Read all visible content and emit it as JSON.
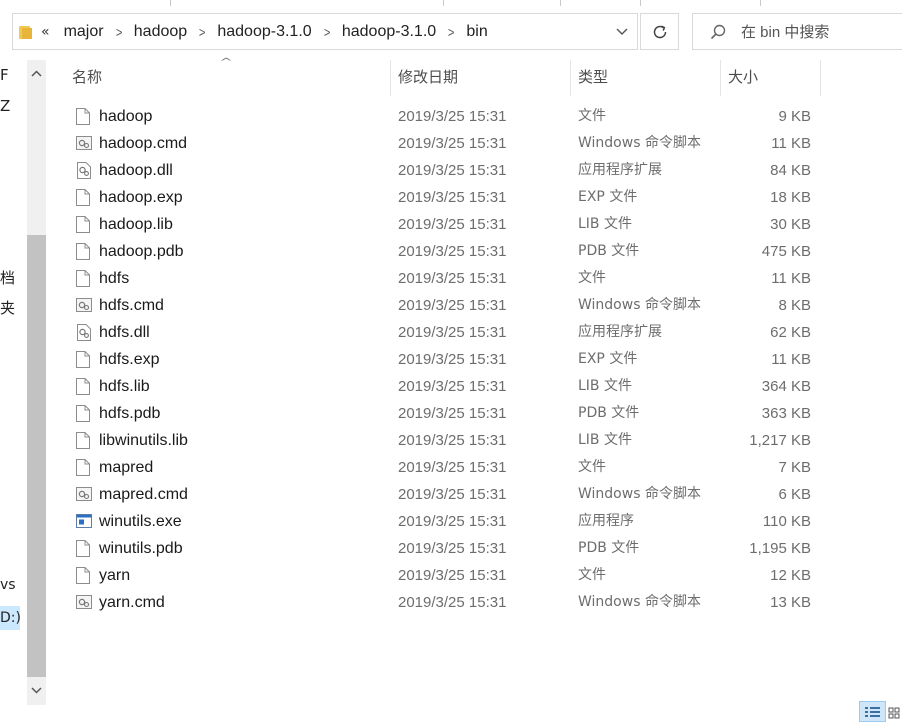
{
  "addressbar": {
    "overflow": "«",
    "crumbs": [
      "major",
      "hadoop",
      "hadoop-3.1.0",
      "hadoop-3.1.0",
      "bin"
    ]
  },
  "search": {
    "placeholder": "在 bin 中搜索"
  },
  "nav_fragments": [
    "F",
    "Z",
    "档",
    "夹",
    "vs (C",
    "D:)"
  ],
  "columns": {
    "name": "名称",
    "date": "修改日期",
    "type": "类型",
    "size": "大小"
  },
  "files": [
    {
      "name": "hadoop",
      "date": "2019/3/25 15:31",
      "type": "文件",
      "size": "9 KB",
      "icon": "blank-file-icon"
    },
    {
      "name": "hadoop.cmd",
      "date": "2019/3/25 15:31",
      "type": "Windows 命令脚本",
      "size": "11 KB",
      "icon": "cmd-script-icon"
    },
    {
      "name": "hadoop.dll",
      "date": "2019/3/25 15:31",
      "type": "应用程序扩展",
      "size": "84 KB",
      "icon": "dll-file-icon"
    },
    {
      "name": "hadoop.exp",
      "date": "2019/3/25 15:31",
      "type": "EXP 文件",
      "size": "18 KB",
      "icon": "blank-file-icon"
    },
    {
      "name": "hadoop.lib",
      "date": "2019/3/25 15:31",
      "type": "LIB 文件",
      "size": "30 KB",
      "icon": "blank-file-icon"
    },
    {
      "name": "hadoop.pdb",
      "date": "2019/3/25 15:31",
      "type": "PDB 文件",
      "size": "475 KB",
      "icon": "blank-file-icon"
    },
    {
      "name": "hdfs",
      "date": "2019/3/25 15:31",
      "type": "文件",
      "size": "11 KB",
      "icon": "blank-file-icon"
    },
    {
      "name": "hdfs.cmd",
      "date": "2019/3/25 15:31",
      "type": "Windows 命令脚本",
      "size": "8 KB",
      "icon": "cmd-script-icon"
    },
    {
      "name": "hdfs.dll",
      "date": "2019/3/25 15:31",
      "type": "应用程序扩展",
      "size": "62 KB",
      "icon": "dll-file-icon"
    },
    {
      "name": "hdfs.exp",
      "date": "2019/3/25 15:31",
      "type": "EXP 文件",
      "size": "11 KB",
      "icon": "blank-file-icon"
    },
    {
      "name": "hdfs.lib",
      "date": "2019/3/25 15:31",
      "type": "LIB 文件",
      "size": "364 KB",
      "icon": "blank-file-icon"
    },
    {
      "name": "hdfs.pdb",
      "date": "2019/3/25 15:31",
      "type": "PDB 文件",
      "size": "363 KB",
      "icon": "blank-file-icon"
    },
    {
      "name": "libwinutils.lib",
      "date": "2019/3/25 15:31",
      "type": "LIB 文件",
      "size": "1,217 KB",
      "icon": "blank-file-icon"
    },
    {
      "name": "mapred",
      "date": "2019/3/25 15:31",
      "type": "文件",
      "size": "7 KB",
      "icon": "blank-file-icon"
    },
    {
      "name": "mapred.cmd",
      "date": "2019/3/25 15:31",
      "type": "Windows 命令脚本",
      "size": "6 KB",
      "icon": "cmd-script-icon"
    },
    {
      "name": "winutils.exe",
      "date": "2019/3/25 15:31",
      "type": "应用程序",
      "size": "110 KB",
      "icon": "exe-app-icon"
    },
    {
      "name": "winutils.pdb",
      "date": "2019/3/25 15:31",
      "type": "PDB 文件",
      "size": "1,195 KB",
      "icon": "blank-file-icon"
    },
    {
      "name": "yarn",
      "date": "2019/3/25 15:31",
      "type": "文件",
      "size": "12 KB",
      "icon": "blank-file-icon"
    },
    {
      "name": "yarn.cmd",
      "date": "2019/3/25 15:31",
      "type": "Windows 命令脚本",
      "size": "13 KB",
      "icon": "cmd-script-icon"
    }
  ]
}
